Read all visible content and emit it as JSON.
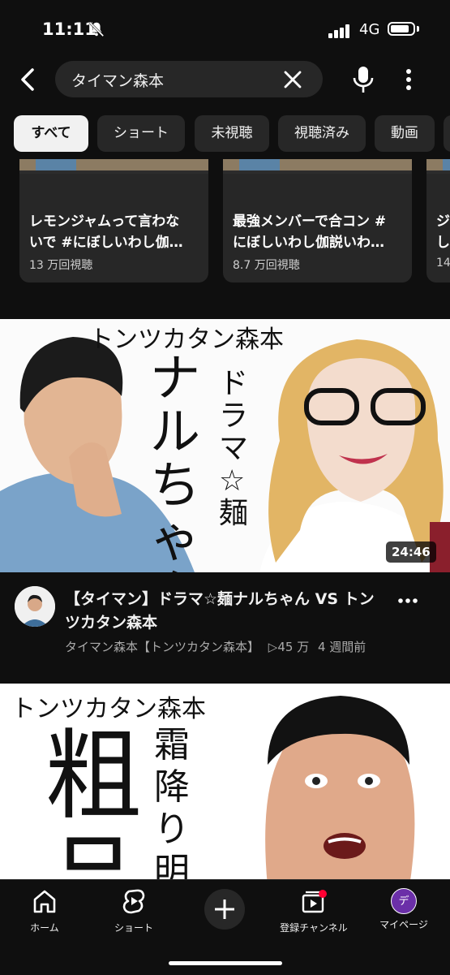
{
  "status": {
    "time": "11:11",
    "network": "4G"
  },
  "search": {
    "query": "タイマン森本"
  },
  "chips": [
    "すべて",
    "ショート",
    "未視聴",
    "視聴済み",
    "動画"
  ],
  "shorts": [
    {
      "title": "レモンジャムって言わないで #にぼしいわし伽…",
      "views": "13 万回視聴"
    },
    {
      "title": "最強メンバーで合コン #にぼしいわし伽説いわ…",
      "views": "8.7 万回視聴"
    },
    {
      "title": "ジ し",
      "views": "14"
    }
  ],
  "video1": {
    "thumb_texts": {
      "top": "トンツカタン森本",
      "big": "ナルちゃん",
      "side": "ドラマ☆麺"
    },
    "duration": "24:46",
    "title": "【タイマン】ドラマ☆麺ナルちゃん VS トンツカタン森本",
    "channel": "タイマン森本【トンツカタン森本】",
    "views": "▷45 万",
    "age": "4 週間前"
  },
  "video2": {
    "thumb_texts": {
      "top": "トンツカタン森本",
      "big": "粗品",
      "side": "霜降り明星"
    }
  },
  "nav": {
    "home": "ホーム",
    "shorts": "ショート",
    "subscriptions": "登録チャンネル",
    "mypage": "マイページ",
    "avatar_letter": "デ"
  },
  "colors": {
    "background": "#0f0f0f",
    "chip_bg": "#272727",
    "active_chip": "#f1f1f1",
    "avatar": "#6b2fa8"
  }
}
